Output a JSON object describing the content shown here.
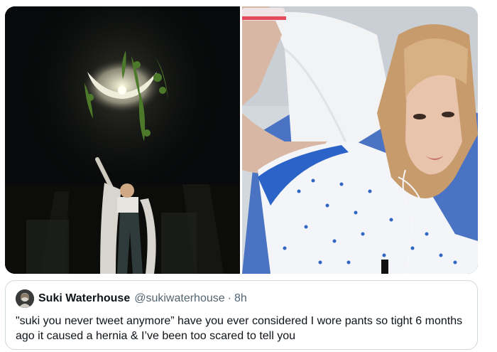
{
  "media": {
    "left_photo": {
      "icon": "concert-moon-photo"
    },
    "right_photo": {
      "icon": "hospital-selfie-photo"
    }
  },
  "quoted_tweet": {
    "author_name": "Suki Waterhouse",
    "author_handle": "@sukiwaterhouse",
    "separator": "·",
    "time": "8h",
    "text": "\"suki you never tweet anymore” have you ever considered I wore pants so tight 6 months ago it caused a hernia & I’ve been too scared to tell you"
  },
  "colors": {
    "text_primary": "#0f1419",
    "text_secondary": "#536471",
    "border": "#cfd9de"
  }
}
